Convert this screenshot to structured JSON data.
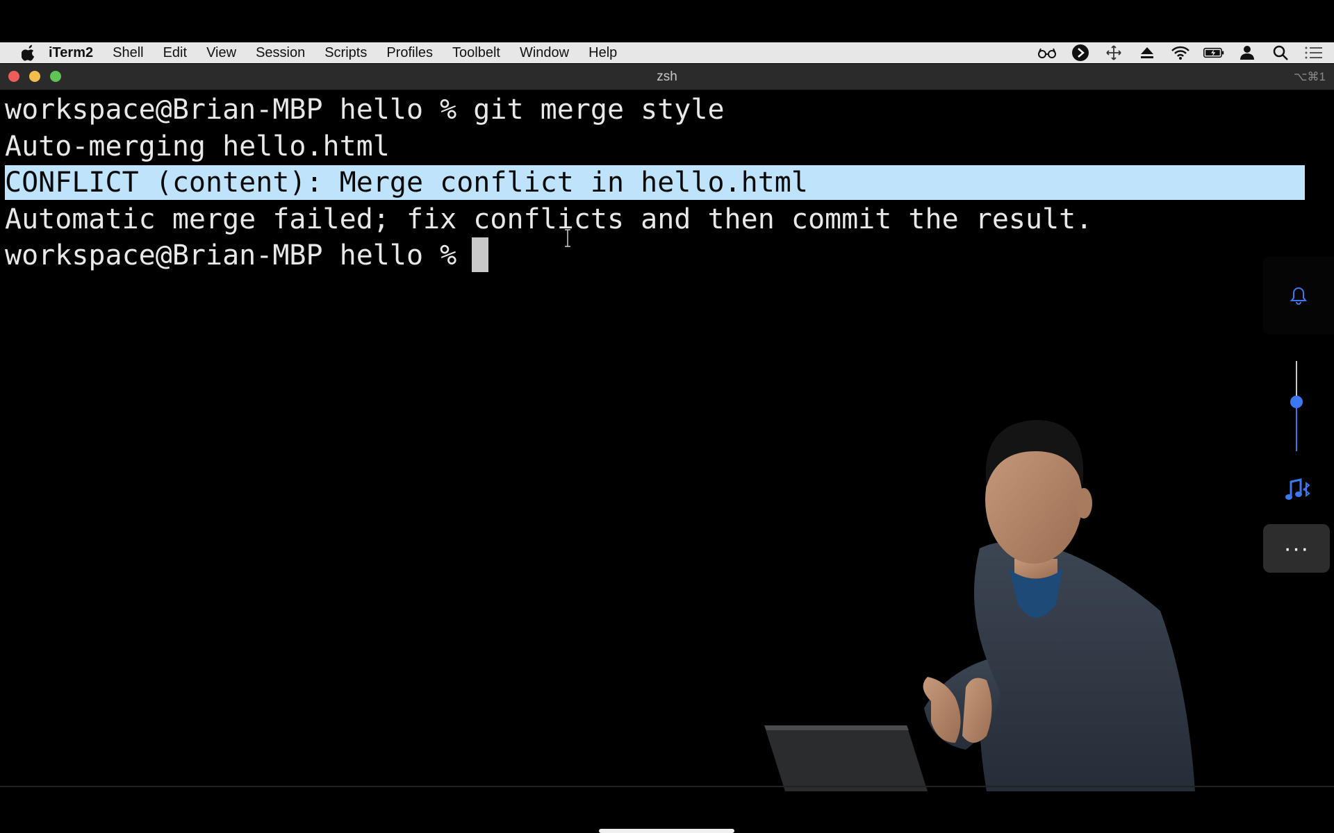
{
  "menubar": {
    "app_name": "iTerm2",
    "items": [
      "Shell",
      "Edit",
      "View",
      "Session",
      "Scripts",
      "Profiles",
      "Toolbelt",
      "Window",
      "Help"
    ],
    "status_icons": [
      "glasses-icon",
      "play-circle-icon",
      "move-icon",
      "eject-icon",
      "wifi-icon",
      "battery-charging-icon",
      "user-icon",
      "search-icon",
      "list-icon"
    ]
  },
  "window": {
    "title": "zsh",
    "shortcut": "⌥⌘1"
  },
  "terminal": {
    "lines": [
      "workspace@Brian-MBP hello % git merge style",
      "Auto-merging hello.html",
      "CONFLICT (content): Merge conflict in hello.html",
      "Automatic merge failed; fix conflicts and then commit the result.",
      "workspace@Brian-MBP hello % "
    ],
    "highlighted_line_index": 2
  },
  "side_panel": {
    "icons": [
      "bell-icon",
      "music-bluetooth-icon"
    ],
    "more_label": "···",
    "volume_level": 0.6
  },
  "colors": {
    "highlight": "#bfe3fb",
    "accent": "#3c78f0",
    "terminal_bg": "#000000",
    "terminal_fg": "#e8e8e8"
  }
}
